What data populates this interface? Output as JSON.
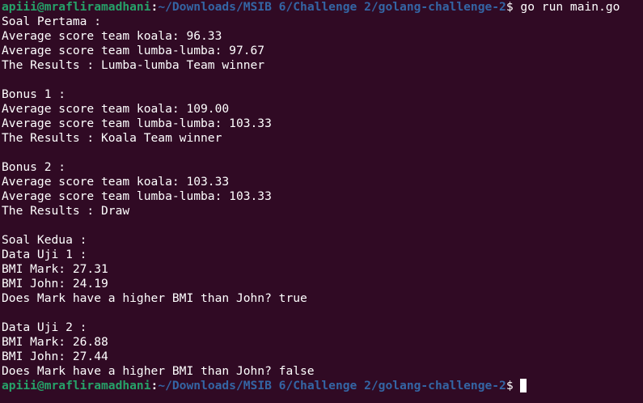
{
  "prompt": {
    "user_host": "apiii@mrafliramadhani",
    "separator": ":",
    "path": "~/Downloads/MSIB 6/Challenge 2/golang-challenge-2",
    "dollar": "$",
    "command": " go run main.go"
  },
  "output": {
    "soal_pertama": {
      "heading": "Soal Pertama :",
      "avg_koala": "Average score team koala: 96.33",
      "avg_lumba": "Average score team lumba-lumba: 97.67",
      "result": "The Results : Lumba-lumba Team winner"
    },
    "bonus1": {
      "heading": "Bonus 1 :",
      "avg_koala": "Average score team koala: 109.00",
      "avg_lumba": "Average score team lumba-lumba: 103.33",
      "result": "The Results : Koala Team winner"
    },
    "bonus2": {
      "heading": "Bonus 2 :",
      "avg_koala": "Average score team koala: 103.33",
      "avg_lumba": "Average score team lumba-lumba: 103.33",
      "result": "The Results : Draw"
    },
    "soal_kedua": {
      "heading": "Soal Kedua :",
      "uji1": {
        "heading": "Data Uji 1 :",
        "bmi_mark": "BMI Mark: 27.31",
        "bmi_john": "BMI John: 24.19",
        "compare": "Does Mark have a higher BMI than John? true"
      },
      "uji2": {
        "heading": "Data Uji 2 :",
        "bmi_mark": "BMI Mark: 26.88",
        "bmi_john": "BMI John: 27.44",
        "compare": "Does Mark have a higher BMI than John? false"
      }
    }
  },
  "colors": {
    "background": "#300a24",
    "prompt_user": "#26a269",
    "prompt_path": "#3465a4",
    "text": "#ffffff"
  }
}
